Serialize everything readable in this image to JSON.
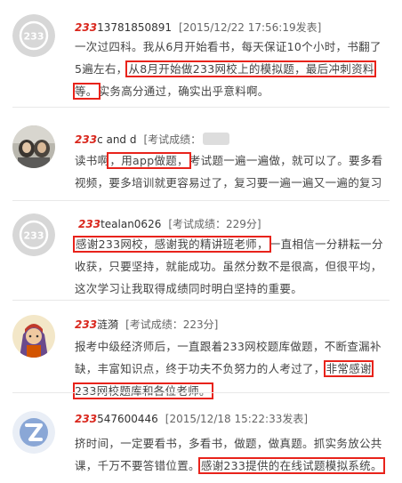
{
  "comments": [
    {
      "brand": "233",
      "username": "13781850891",
      "meta": "[2015/12/22 17:56:19发表]",
      "text_before": "一次过四科。我从6月开始看书，每天保证10个小时，书翻了5遍左右，",
      "highlight": "从8月开始做233网校上的模拟题，最后冲刺资料等。",
      "text_after": "实务高分通过，确实出乎意料啊。"
    },
    {
      "brand": "233",
      "username": "c and d",
      "meta": "[考试成绩：",
      "text_before": "读书啊",
      "highlight": "，用app做题，",
      "text_after": "考试题一遍一遍做，就可以了。要多看视频，要多培训就更容易过了，复习要一遍一遍又一遍的复习"
    },
    {
      "brand": "233",
      "username": "tealan0626",
      "meta": "[考试成绩：229分]",
      "text_before": "",
      "highlight": "感谢233网校，感谢我的精讲班老师，",
      "text_after": "一直相信一分耕耘一分收获，只要坚持，就能成功。虽然分数不是很高，但很平均，这次学习让我取得成绩同时明白坚持的重要。"
    },
    {
      "brand": "233",
      "username": "涟漪",
      "meta": "[考试成绩：223分]",
      "text_before": "报考中级经济师后，一直跟着233网校题库做题，不断查漏补缺，丰富知识点，终于功夫不负努力的人考过了，",
      "highlight": "非常感谢233网校题库和各位老师。",
      "text_after": ""
    },
    {
      "brand": "233",
      "username": "547600446",
      "meta": "[2015/12/18 15:22:33发表]",
      "text_before": "挤时间，一定要看书，多看书，做题，做真题。抓实务放公共课，千万不要答错位置。",
      "highlight": "感谢233提供的在线试题模拟系统。",
      "text_after": ""
    }
  ],
  "icons": {
    "c1": "default-233-avatar-icon",
    "c2": "photo-avatar-icon",
    "c3": "default-233-avatar-icon",
    "c4": "cartoon-avatar-icon",
    "c5": "z-logo-avatar-icon"
  },
  "colors": {
    "brand_red": "#d9261c",
    "highlight_box": "#e8231b",
    "z_blue": "#8aa7d6"
  }
}
